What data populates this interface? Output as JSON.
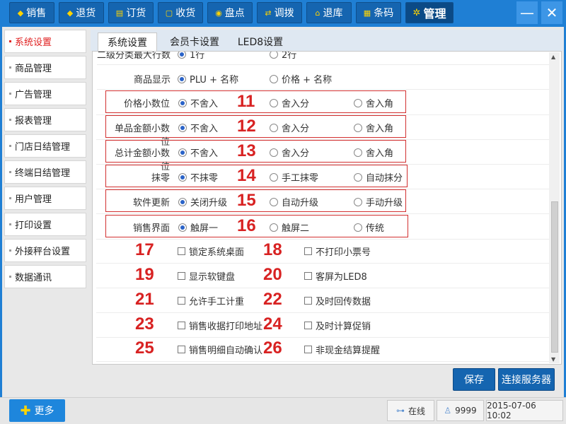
{
  "nav": [
    {
      "icon": "◆",
      "label": "销售"
    },
    {
      "icon": "◆",
      "label": "退货"
    },
    {
      "icon": "▤",
      "label": "订货"
    },
    {
      "icon": "▢",
      "label": "收货"
    },
    {
      "icon": "◉",
      "label": "盘点"
    },
    {
      "icon": "⇄",
      "label": "调拨"
    },
    {
      "icon": "⌂",
      "label": "退库"
    },
    {
      "icon": "▦",
      "label": "条码"
    },
    {
      "icon": "✲",
      "label": "管理"
    }
  ],
  "window": {
    "minimize": "—",
    "close": "✕"
  },
  "sidebar": [
    "系统设置",
    "商品管理",
    "广告管理",
    "报表管理",
    "门店日结管理",
    "终端日结管理",
    "用户管理",
    "打印设置",
    "外接秤台设置",
    "数据通讯"
  ],
  "tabs": [
    "系统设置",
    "会员卡设置",
    "LED8设置"
  ],
  "settings": {
    "partial_row": {
      "label": "二级分类最大行数",
      "opt1": "1行",
      "opt2": "2行"
    },
    "product_display": {
      "label": "商品显示",
      "opt1": "PLU + 名称",
      "opt2": "价格 + 名称"
    },
    "radio_rows": [
      {
        "label": "价格小数位",
        "opts": [
          "不舍入",
          "舍入分",
          "舍入角"
        ],
        "num": "11"
      },
      {
        "label": "单品金额小数位",
        "opts": [
          "不舍入",
          "舍入分",
          "舍入角"
        ],
        "num": "12"
      },
      {
        "label": "总计金额小数位",
        "opts": [
          "不舍入",
          "舍入分",
          "舍入角"
        ],
        "num": "13"
      },
      {
        "label": "抹零",
        "opts": [
          "不抹零",
          "手工抹零",
          "自动抹分"
        ],
        "num": "14"
      },
      {
        "label": "软件更新",
        "opts": [
          "关闭升级",
          "自动升级",
          "手动升级"
        ],
        "num": "15"
      },
      {
        "label": "销售界面",
        "opts": [
          "触屏一",
          "触屏二",
          "传统"
        ],
        "num": "16"
      }
    ],
    "checks": [
      {
        "numL": "17",
        "textL": "锁定系统桌面",
        "numR": "18",
        "textR": "不打印小票号"
      },
      {
        "numL": "19",
        "textL": "显示软键盘",
        "numR": "20",
        "textR": "客屏为LED8"
      },
      {
        "numL": "21",
        "textL": "允许手工计重",
        "numR": "22",
        "textR": "及时回传数据"
      },
      {
        "numL": "23",
        "textL": "销售收据打印地址",
        "numR": "24",
        "textR": "及时计算促销"
      },
      {
        "numL": "25",
        "textL": "销售明细自动确认",
        "numR": "26",
        "textR": "非现金结算提醒"
      }
    ]
  },
  "actions": {
    "save": "保存",
    "connect": "连接服务器"
  },
  "footer": {
    "more": "更多",
    "online": "在线",
    "user": "9999",
    "datetime": "2015-07-06 10:02"
  }
}
